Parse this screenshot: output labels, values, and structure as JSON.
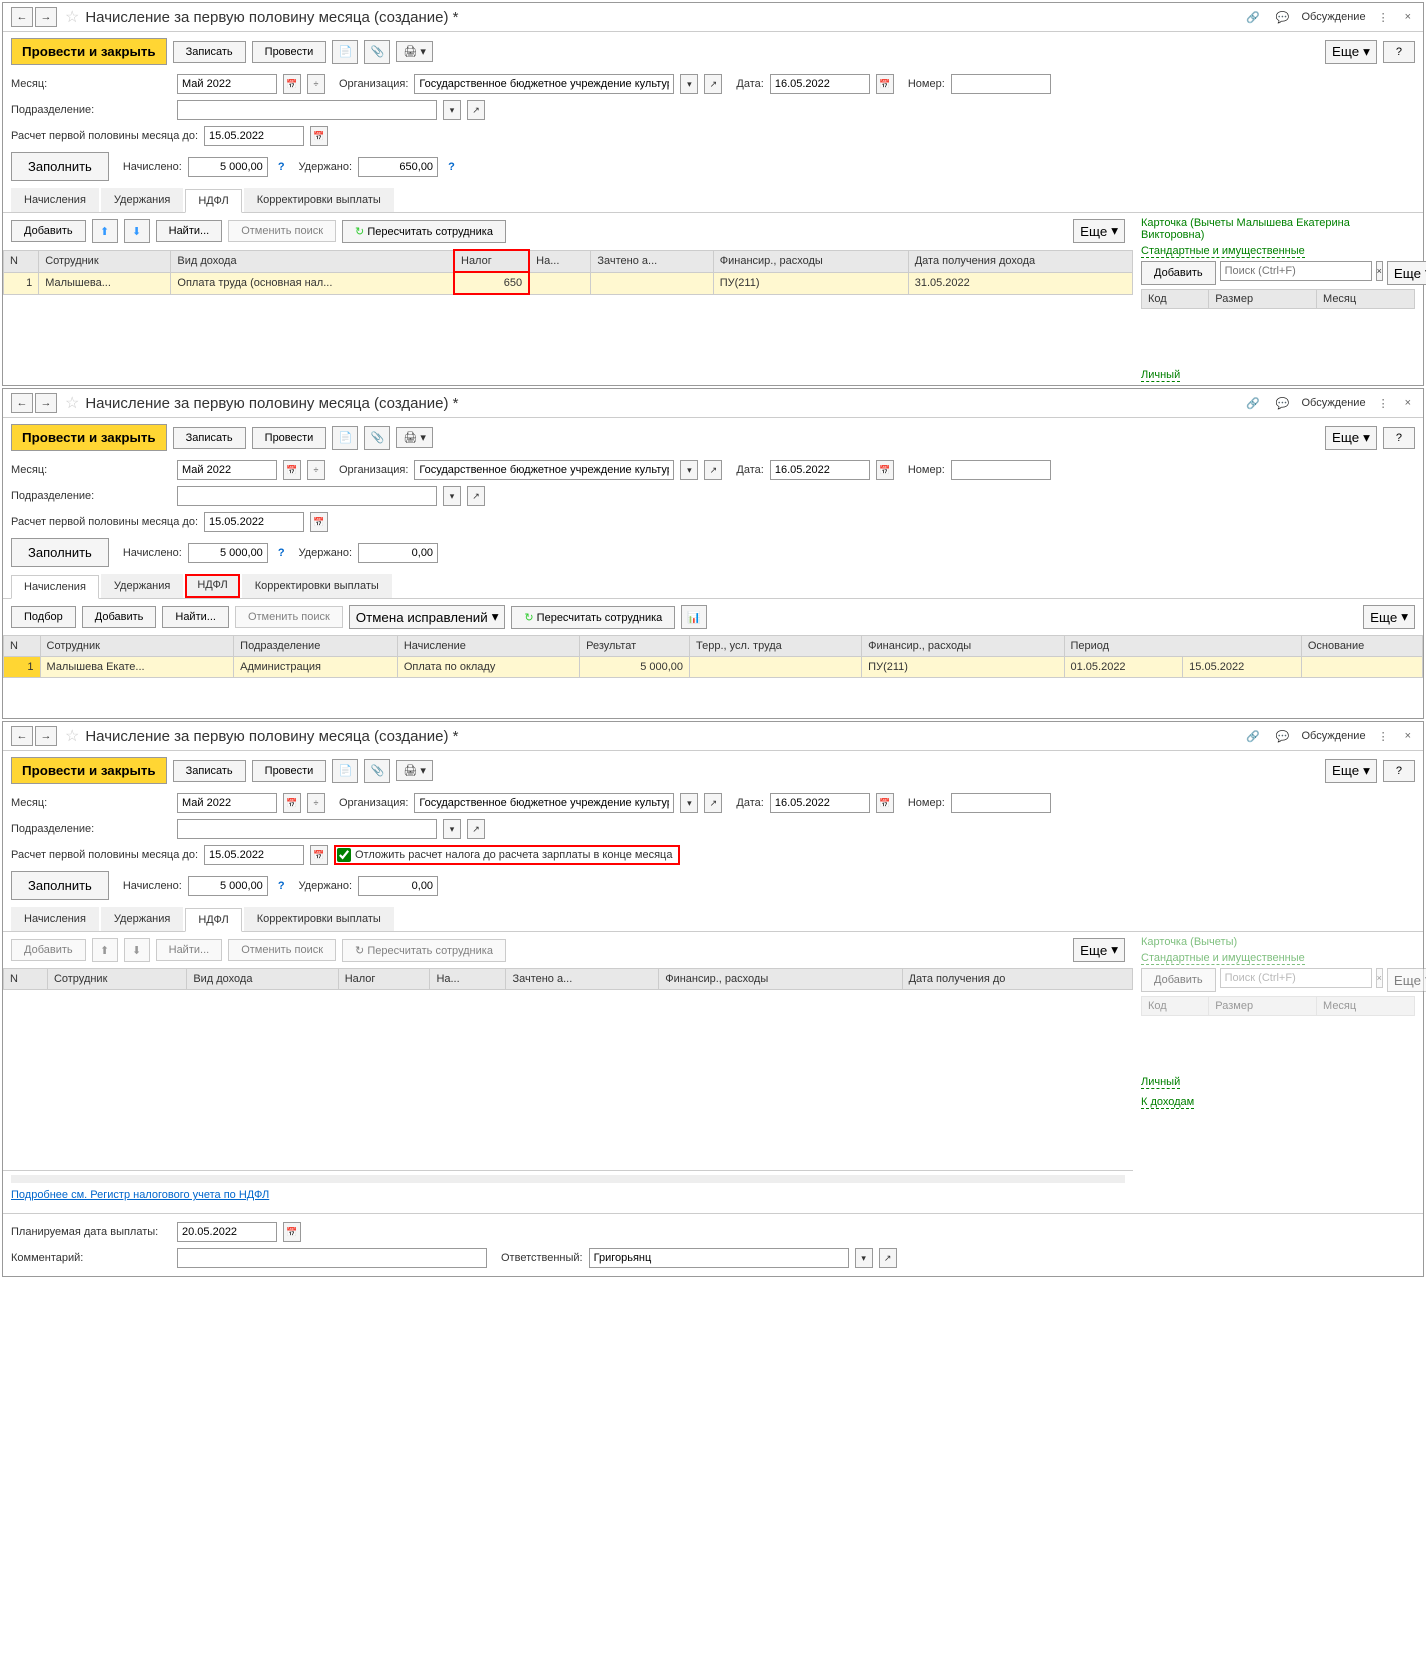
{
  "w1": {
    "title": "Начисление за первую половину месяца (создание) *",
    "discuss": "Обсуждение",
    "toolbar": {
      "post_close": "Провести и закрыть",
      "save": "Записать",
      "post": "Провести",
      "more": "Еще",
      "help": "?"
    },
    "fields": {
      "month_label": "Месяц:",
      "month": "Май 2022",
      "org_label": "Организация:",
      "org": "Государственное бюджетное учреждение культуры \"Театрал",
      "date_label": "Дата:",
      "date": "16.05.2022",
      "number_label": "Номер:",
      "dept_label": "Подразделение:",
      "calc_label": "Расчет первой половины месяца до:",
      "calc_date": "15.05.2022",
      "fill": "Заполнить",
      "accrued_label": "Начислено:",
      "accrued": "5 000,00",
      "withheld_label": "Удержано:",
      "withheld": "650,00"
    },
    "tabs": {
      "accruals": "Начисления",
      "deductions": "Удержания",
      "ndfl": "НДФЛ",
      "corrections": "Корректировки выплаты"
    },
    "sub": {
      "add": "Добавить",
      "find": "Найти...",
      "cancel_search": "Отменить поиск",
      "recalc": "Пересчитать сотрудника",
      "more": "Еще"
    },
    "cols": {
      "n": "N",
      "emp": "Сотрудник",
      "income_type": "Вид дохода",
      "tax": "Налог",
      "on": "На...",
      "credited": "Зачтено а...",
      "fin": "Финансир., расходы",
      "date": "Дата получения дохода"
    },
    "row": {
      "n": "1",
      "emp": "Малышева...",
      "income_type": "Оплата труда (основная нал...",
      "tax": "650",
      "fin": "ПУ(211)",
      "date": "31.05.2022"
    },
    "right": {
      "card": "Карточка (Вычеты Малышева Екатерина Викторовна)",
      "std": "Стандартные и имущественные",
      "add": "Добавить",
      "placeholder": "Поиск (Ctrl+F)",
      "more": "Еще",
      "code": "Код",
      "size": "Размер",
      "month": "Месяц",
      "personal": "Личный"
    }
  },
  "w2": {
    "title": "Начисление за первую половину месяца (создание) *",
    "fields": {
      "withheld": "0,00"
    },
    "sub": {
      "selection": "Подбор",
      "add": "Добавить",
      "find": "Найти...",
      "cancel_search": "Отменить поиск",
      "cancel_fix": "Отмена исправлений",
      "recalc": "Пересчитать сотрудника",
      "more": "Еще"
    },
    "cols": {
      "n": "N",
      "emp": "Сотрудник",
      "dept": "Подразделение",
      "accrual": "Начисление",
      "result": "Результат",
      "terr": "Терр., усл. труда",
      "fin": "Финансир., расходы",
      "period": "Период",
      "basis": "Основание"
    },
    "row": {
      "n": "1",
      "emp": "Малышева Екате...",
      "dept": "Администрация",
      "accrual": "Оплата по окладу",
      "result": "5 000,00",
      "fin": "ПУ(211)",
      "p1": "01.05.2022",
      "p2": "15.05.2022"
    }
  },
  "w3": {
    "title": "Начисление за первую половину месяца (создание) *",
    "fields": {
      "defer": "Отложить расчет налога до расчета зарплаты в конце месяца",
      "withheld": "0,00"
    },
    "cols": {
      "n": "N",
      "emp": "Сотрудник",
      "income_type": "Вид дохода",
      "tax": "Налог",
      "on": "На...",
      "credited": "Зачтено а...",
      "fin": "Финансир., расходы",
      "date": "Дата получения до"
    },
    "right": {
      "card": "Карточка (Вычеты)",
      "std": "Стандартные и имущественные",
      "personal": "Личный",
      "to_income": "К доходам"
    },
    "footer": {
      "more_link": "Подробнее см. Регистр налогового учета по НДФЛ",
      "planned_label": "Планируемая дата выплаты:",
      "planned": "20.05.2022",
      "comment_label": "Комментарий:",
      "resp_label": "Ответственный:",
      "resp": "Григорьянц"
    }
  }
}
